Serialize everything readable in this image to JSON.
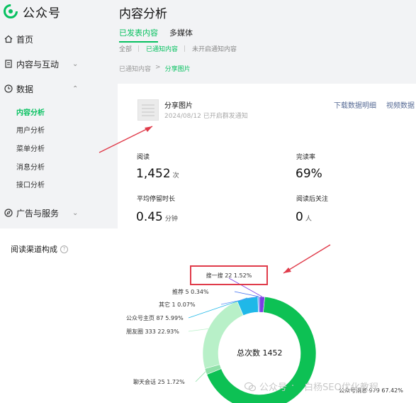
{
  "app": {
    "name": "公众号",
    "brand_color": "#07c160"
  },
  "sidebar": {
    "items": [
      {
        "label": "首页",
        "icon": "home-icon"
      },
      {
        "label": "内容与互动",
        "icon": "document-icon"
      },
      {
        "label": "数据",
        "icon": "clock-icon"
      },
      {
        "label": "广告与服务",
        "icon": "compass-icon"
      }
    ],
    "data_submenu": [
      {
        "label": "内容分析",
        "active": true
      },
      {
        "label": "用户分析",
        "active": false
      },
      {
        "label": "菜单分析",
        "active": false
      },
      {
        "label": "消息分析",
        "active": false
      },
      {
        "label": "接口分析",
        "active": false
      }
    ]
  },
  "main": {
    "title": "内容分析",
    "tabs": [
      "已发表内容",
      "多媒体"
    ],
    "subtabs": [
      "全部",
      "已通知内容",
      "未开启通知内容"
    ],
    "breadcrumb": {
      "parent": "已通知内容",
      "separator": ">",
      "current": "分享图片"
    }
  },
  "article": {
    "title": "分享图片",
    "meta": "2024/08/12 已开启群发通知",
    "download_link": "下载数据明细",
    "video_link": "视频数据"
  },
  "stats": {
    "reads_label": "阅读",
    "reads_value": "1,452",
    "reads_unit": "次",
    "completion_label": "完读率",
    "completion_value": "69%",
    "avg_time_label": "平均停留时长",
    "avg_time_value": "0.45",
    "avg_time_unit": "分钟",
    "follow_label": "阅读后关注",
    "follow_value": "0",
    "follow_unit": "人"
  },
  "channel_section": {
    "title": "阅读渠道构成",
    "info_icon": "info-icon"
  },
  "chart_data": {
    "type": "pie",
    "center_label": "总次数 1452",
    "total": 1452,
    "slices": [
      {
        "name": "搜一搜",
        "value": 22,
        "percent": "1.52%",
        "label": "搜一搜 22 1.52%",
        "color": "#7b3fe4"
      },
      {
        "name": "推荐",
        "value": 5,
        "percent": "0.34%",
        "label": "推荐 5 0.34%",
        "color": "#3a6df0"
      },
      {
        "name": "其它",
        "value": 1,
        "percent": "0.07%",
        "label": "其它 1 0.07%",
        "color": "#5b8ff9"
      },
      {
        "name": "公众号主页",
        "value": 87,
        "percent": "5.99%",
        "label": "公众号主页 87 5.99%",
        "color": "#1fb8e8"
      },
      {
        "name": "朋友圈",
        "value": 333,
        "percent": "22.93%",
        "label": "朋友圈 333 22.93%",
        "color": "#b8f0c8"
      },
      {
        "name": "聊天会话",
        "value": 25,
        "percent": "1.72%",
        "label": "聊天会话 25 1.72%",
        "color": "#8fe0a8"
      },
      {
        "name": "公众号消息",
        "value": 979,
        "percent": "67.42%",
        "label": "公众号消息 979 67.42%",
        "color": "#0dc154"
      }
    ]
  },
  "highlight_box": {
    "text": "搜一搜 22 1.52%",
    "color": "#e03b4a"
  },
  "watermark": {
    "prefix": "公众号",
    "separator": "·",
    "account": "白杨SEO优化教程"
  }
}
